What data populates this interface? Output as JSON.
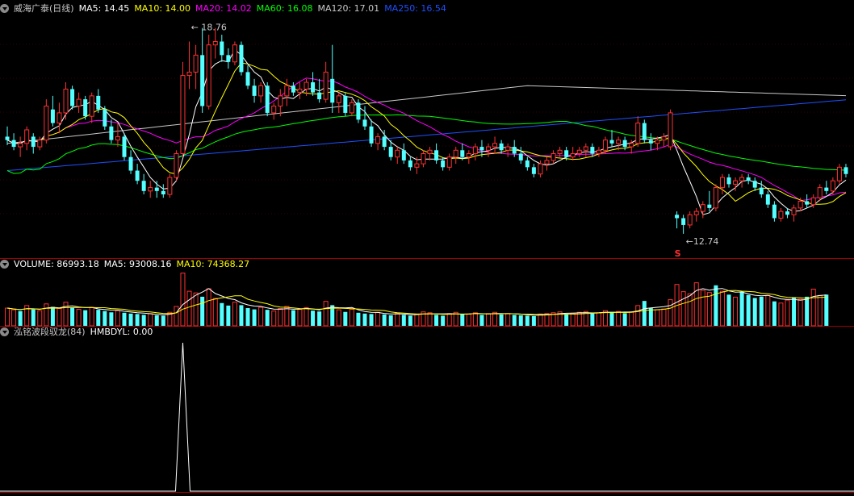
{
  "price_panel": {
    "title": "威海广泰(日线)",
    "ma_legend": [
      {
        "label": "MA5: 14.45",
        "color": "#ffffff"
      },
      {
        "label": "MA10: 14.00",
        "color": "#ffff00"
      },
      {
        "label": "MA20: 14.02",
        "color": "#ff00ff"
      },
      {
        "label": "MA60: 16.08",
        "color": "#00ff00"
      },
      {
        "label": "MA120: 17.01",
        "color": "#c8c8c8"
      },
      {
        "label": "MA250: 16.54",
        "color": "#1e50ff"
      }
    ],
    "high_label": "18.76",
    "low_label": "12.74",
    "marker_label": "S"
  },
  "volume_panel": {
    "legend": [
      {
        "label": "VOLUME: 86993.18",
        "color": "#ffffff"
      },
      {
        "label": "MA5: 93008.16",
        "color": "#ffffff"
      },
      {
        "label": "MA10: 74368.27",
        "color": "#ffff00"
      }
    ]
  },
  "indicator_panel": {
    "legend": [
      {
        "label": "泓铭波段驭龙(84)",
        "color": "#c8c8c8"
      },
      {
        "label": "HMBDYL: 0.00",
        "color": "#ffffff"
      }
    ]
  },
  "chart_data": {
    "type": "candlestick",
    "up_color": "#ff3232",
    "down_color": "#54ffff",
    "candles": [
      [
        15.6,
        15.9,
        15.35,
        15.5
      ],
      [
        15.5,
        15.7,
        15.2,
        15.3
      ],
      [
        15.3,
        15.6,
        15.0,
        15.4
      ],
      [
        15.4,
        15.9,
        15.2,
        15.8
      ],
      [
        15.6,
        15.7,
        15.1,
        15.3
      ],
      [
        15.3,
        15.6,
        15.2,
        15.5
      ],
      [
        15.5,
        16.7,
        15.4,
        16.5
      ],
      [
        16.4,
        16.8,
        15.9,
        16.0
      ],
      [
        16.0,
        16.6,
        15.7,
        16.3
      ],
      [
        16.3,
        17.2,
        16.1,
        17.0
      ],
      [
        17.0,
        17.1,
        16.4,
        16.5
      ],
      [
        16.5,
        16.9,
        16.3,
        16.7
      ],
      [
        16.7,
        16.8,
        16.1,
        16.2
      ],
      [
        16.2,
        16.9,
        16.0,
        16.8
      ],
      [
        16.8,
        17.0,
        16.3,
        16.4
      ],
      [
        16.4,
        16.5,
        15.8,
        15.9
      ],
      [
        15.9,
        16.1,
        15.4,
        15.5
      ],
      [
        15.5,
        16.0,
        15.3,
        15.6
      ],
      [
        15.6,
        15.7,
        14.9,
        15.0
      ],
      [
        15.0,
        15.2,
        14.5,
        14.6
      ],
      [
        14.6,
        14.8,
        14.2,
        14.3
      ],
      [
        14.3,
        14.5,
        13.9,
        14.0
      ],
      [
        14.0,
        14.3,
        13.8,
        14.1
      ],
      [
        14.1,
        14.3,
        13.8,
        14.0
      ],
      [
        14.0,
        14.2,
        13.8,
        13.9
      ],
      [
        13.9,
        14.5,
        13.8,
        14.4
      ],
      [
        14.4,
        15.2,
        14.3,
        15.1
      ],
      [
        15.1,
        17.8,
        15.0,
        17.4
      ],
      [
        17.4,
        18.4,
        17.0,
        17.5
      ],
      [
        17.5,
        18.3,
        17.0,
        18.0
      ],
      [
        18.0,
        18.8,
        16.3,
        16.5
      ],
      [
        16.5,
        18.6,
        16.4,
        18.3
      ],
      [
        18.3,
        18.8,
        17.9,
        18.4
      ],
      [
        18.4,
        18.6,
        17.8,
        18.0
      ],
      [
        18.0,
        18.2,
        17.6,
        17.8
      ],
      [
        17.8,
        18.4,
        17.7,
        18.3
      ],
      [
        18.3,
        18.4,
        17.4,
        17.5
      ],
      [
        17.5,
        17.7,
        17.0,
        17.1
      ],
      [
        17.1,
        17.3,
        16.6,
        16.8
      ],
      [
        16.8,
        17.2,
        16.6,
        17.1
      ],
      [
        17.1,
        17.2,
        16.2,
        16.3
      ],
      [
        16.3,
        16.6,
        16.1,
        16.5
      ],
      [
        16.5,
        17.0,
        16.2,
        16.8
      ],
      [
        16.8,
        17.3,
        16.5,
        17.1
      ],
      [
        17.1,
        17.2,
        16.8,
        16.9
      ],
      [
        16.9,
        17.2,
        16.7,
        17.0
      ],
      [
        17.0,
        17.3,
        16.8,
        17.2
      ],
      [
        17.2,
        17.5,
        16.8,
        16.9
      ],
      [
        16.9,
        17.3,
        16.6,
        16.7
      ],
      [
        16.7,
        17.8,
        16.6,
        17.5
      ],
      [
        17.3,
        18.3,
        16.3,
        16.6
      ],
      [
        16.6,
        16.9,
        16.3,
        16.8
      ],
      [
        16.8,
        16.9,
        16.2,
        16.3
      ],
      [
        16.3,
        16.7,
        16.2,
        16.6
      ],
      [
        16.6,
        16.7,
        16.0,
        16.1
      ],
      [
        16.1,
        16.5,
        15.8,
        15.9
      ],
      [
        15.9,
        16.1,
        15.3,
        15.4
      ],
      [
        15.4,
        15.7,
        15.2,
        15.6
      ],
      [
        15.6,
        15.8,
        15.2,
        15.3
      ],
      [
        15.3,
        15.5,
        14.9,
        15.0
      ],
      [
        15.0,
        15.3,
        14.8,
        15.2
      ],
      [
        15.2,
        15.4,
        14.8,
        14.9
      ],
      [
        14.9,
        15.0,
        14.6,
        14.7
      ],
      [
        14.7,
        15.0,
        14.5,
        14.8
      ],
      [
        14.8,
        15.2,
        14.7,
        15.1
      ],
      [
        15.1,
        15.3,
        14.9,
        15.2
      ],
      [
        15.2,
        15.4,
        14.8,
        14.9
      ],
      [
        14.9,
        15.0,
        14.6,
        14.7
      ],
      [
        14.7,
        15.1,
        14.6,
        15.0
      ],
      [
        15.0,
        15.3,
        14.8,
        15.2
      ],
      [
        15.2,
        15.4,
        14.9,
        15.0
      ],
      [
        15.0,
        15.2,
        14.8,
        15.1
      ],
      [
        15.1,
        15.4,
        14.9,
        15.3
      ],
      [
        15.3,
        15.5,
        15.0,
        15.2
      ],
      [
        15.2,
        15.4,
        15.0,
        15.3
      ],
      [
        15.3,
        15.6,
        15.1,
        15.4
      ],
      [
        15.4,
        15.5,
        15.1,
        15.2
      ],
      [
        15.2,
        15.4,
        15.0,
        15.3
      ],
      [
        15.3,
        15.5,
        15.0,
        15.1
      ],
      [
        15.1,
        15.3,
        14.8,
        14.9
      ],
      [
        14.9,
        15.0,
        14.6,
        14.7
      ],
      [
        14.7,
        14.8,
        14.4,
        14.5
      ],
      [
        14.5,
        14.9,
        14.4,
        14.8
      ],
      [
        14.8,
        15.0,
        14.6,
        14.9
      ],
      [
        14.9,
        15.2,
        14.8,
        15.1
      ],
      [
        15.1,
        15.3,
        15.0,
        15.2
      ],
      [
        15.2,
        15.3,
        14.9,
        15.0
      ],
      [
        15.0,
        15.3,
        14.9,
        15.1
      ],
      [
        15.1,
        15.3,
        15.0,
        15.2
      ],
      [
        15.2,
        15.4,
        15.0,
        15.3
      ],
      [
        15.3,
        15.4,
        15.0,
        15.1
      ],
      [
        15.1,
        15.3,
        15.0,
        15.2
      ],
      [
        15.2,
        15.6,
        15.1,
        15.5
      ],
      [
        15.5,
        15.8,
        15.3,
        15.4
      ],
      [
        15.4,
        15.6,
        15.2,
        15.5
      ],
      [
        15.5,
        15.6,
        15.2,
        15.3
      ],
      [
        15.3,
        15.5,
        15.1,
        15.4
      ],
      [
        15.4,
        16.2,
        15.3,
        16.0
      ],
      [
        16.0,
        16.1,
        15.4,
        15.5
      ],
      [
        15.5,
        15.7,
        15.2,
        15.4
      ],
      [
        15.4,
        15.6,
        15.2,
        15.5
      ],
      [
        15.5,
        15.7,
        15.3,
        15.6
      ],
      [
        15.3,
        16.4,
        15.2,
        16.3
      ],
      [
        13.3,
        13.4,
        12.9,
        13.2
      ],
      [
        13.2,
        13.3,
        12.74,
        13.0
      ],
      [
        13.0,
        13.4,
        12.9,
        13.3
      ],
      [
        13.3,
        13.5,
        13.1,
        13.4
      ],
      [
        13.4,
        13.7,
        13.2,
        13.6
      ],
      [
        13.6,
        14.0,
        13.4,
        13.5
      ],
      [
        13.5,
        14.2,
        13.4,
        14.1
      ],
      [
        14.1,
        14.5,
        13.9,
        14.4
      ],
      [
        14.4,
        14.5,
        14.1,
        14.2
      ],
      [
        14.2,
        14.4,
        14.0,
        14.3
      ],
      [
        14.3,
        14.5,
        14.1,
        14.4
      ],
      [
        14.4,
        14.5,
        14.2,
        14.3
      ],
      [
        14.3,
        14.4,
        14.0,
        14.1
      ],
      [
        14.1,
        14.3,
        13.8,
        13.9
      ],
      [
        13.9,
        14.0,
        13.5,
        13.6
      ],
      [
        13.6,
        13.7,
        13.1,
        13.2
      ],
      [
        13.2,
        13.5,
        13.1,
        13.4
      ],
      [
        13.4,
        13.5,
        13.2,
        13.3
      ],
      [
        13.3,
        13.6,
        13.1,
        13.5
      ],
      [
        13.5,
        13.8,
        13.4,
        13.7
      ],
      [
        13.7,
        13.9,
        13.5,
        13.6
      ],
      [
        13.6,
        13.9,
        13.5,
        13.8
      ],
      [
        13.8,
        14.2,
        13.7,
        14.1
      ],
      [
        14.1,
        14.3,
        13.9,
        14.0
      ],
      [
        14.0,
        14.4,
        13.9,
        14.3
      ],
      [
        14.3,
        14.8,
        14.2,
        14.7
      ],
      [
        14.7,
        14.8,
        14.4,
        14.5
      ]
    ],
    "volume_up": [
      1,
      1,
      0,
      1,
      0,
      1,
      1,
      0,
      1,
      1,
      0,
      1,
      0,
      1,
      0,
      0,
      0,
      1,
      0,
      0,
      0,
      0,
      1,
      0,
      0,
      1,
      1,
      1,
      1,
      1,
      0,
      1,
      1,
      0,
      0,
      1,
      0,
      0,
      0,
      1,
      0,
      1,
      1,
      1,
      0,
      1,
      1,
      0,
      0,
      1,
      0,
      1,
      0,
      1,
      0,
      0,
      0,
      1,
      0,
      0,
      1,
      0,
      0,
      1,
      1,
      1,
      0,
      0,
      1,
      1,
      0,
      1,
      1,
      0,
      1,
      1,
      0,
      1,
      0,
      0,
      0,
      0,
      1,
      1,
      1,
      1,
      0,
      1,
      1,
      1,
      0,
      1,
      1,
      0,
      1,
      0,
      1,
      1,
      0,
      0,
      1,
      1,
      1,
      1,
      1,
      1,
      1,
      1,
      1,
      0,
      1,
      0,
      1,
      0,
      0,
      0,
      0,
      1,
      0,
      1,
      1,
      0,
      1,
      0,
      1,
      1,
      0
    ],
    "volume": [
      4.2,
      3.8,
      3.5,
      4.8,
      3.9,
      3.6,
      5.2,
      4.5,
      4.1,
      5.6,
      4.3,
      3.9,
      3.7,
      4.4,
      3.8,
      3.5,
      3.2,
      3.6,
      3.1,
      2.9,
      2.8,
      2.6,
      2.9,
      2.5,
      2.4,
      3.2,
      4.6,
      12.5,
      8.2,
      7.8,
      6.9,
      8.8,
      6.5,
      5.4,
      4.8,
      5.6,
      4.9,
      4.2,
      3.9,
      4.4,
      3.8,
      3.5,
      4.1,
      4.6,
      3.7,
      3.9,
      4.3,
      3.6,
      3.4,
      5.8,
      4.9,
      3.8,
      3.3,
      3.9,
      3.1,
      2.9,
      2.8,
      3.2,
      2.7,
      2.5,
      3.0,
      2.6,
      2.4,
      2.8,
      3.3,
      3.1,
      2.6,
      2.4,
      2.9,
      3.2,
      2.7,
      2.8,
      3.1,
      2.6,
      2.9,
      3.2,
      2.7,
      2.9,
      2.6,
      2.5,
      2.4,
      2.3,
      2.8,
      2.9,
      3.1,
      3.3,
      2.8,
      3.0,
      3.2,
      3.4,
      2.9,
      3.1,
      3.6,
      3.2,
      3.4,
      3.0,
      3.3,
      4.8,
      5.9,
      4.2,
      3.8,
      4.0,
      6.2,
      9.8,
      8.1,
      7.6,
      10.2,
      8.4,
      7.9,
      9.6,
      8.2,
      7.4,
      6.8,
      8.1,
      7.3,
      6.6,
      6.9,
      7.2,
      5.8,
      5.4,
      6.1,
      6.8,
      6.3,
      6.9,
      8.7,
      7.2,
      7.4
    ],
    "volume_ma5_label": "MA5",
    "volume_ma10_label": "MA10",
    "indicator": {
      "name": "HMBDYL",
      "spike_index": 27,
      "spike_value": 1
    }
  }
}
